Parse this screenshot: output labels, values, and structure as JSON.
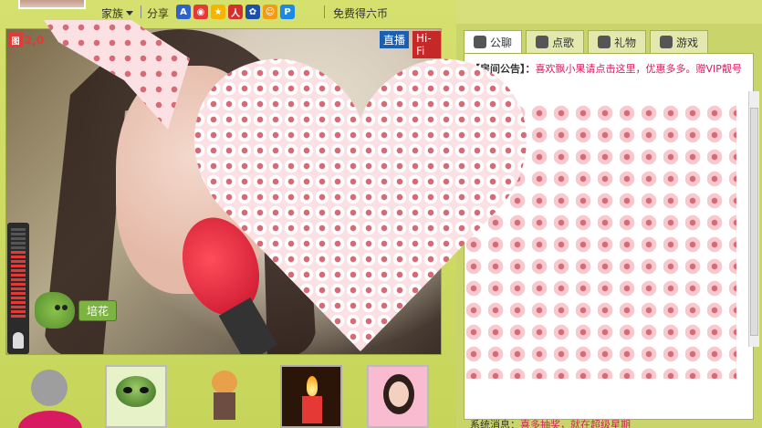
{
  "topbar": {
    "family_label": "家族",
    "share_label": "分享",
    "free_coin_label": "免费得六币",
    "share_icons": [
      "baidu-icon",
      "weibo-icon",
      "qzone-icon",
      "renren-icon",
      "paw-icon",
      "kaixin-icon",
      "pengyou-icon"
    ]
  },
  "video": {
    "live_label": "直播",
    "hifi_label": "Hi-Fi",
    "viewer_count": "2,0"
  },
  "peihua_label": "培花",
  "right": {
    "tabs": [
      {
        "label": "公聊",
        "icon": "chat-icon"
      },
      {
        "label": "点歌",
        "icon": "microphone-icon"
      },
      {
        "label": "礼物",
        "icon": "gift-icon"
      },
      {
        "label": "游戏",
        "icon": "gamepad-icon"
      }
    ],
    "announcement_label": "【房间公告】：",
    "announcement_text": "喜欢飘小果请点击这里，优惠多多。赠VIP靓号",
    "system_label": "系统消息：",
    "system_text": "喜多抽奖，就在超级星期"
  },
  "colors": {
    "background": "#c7d96a",
    "accent_pink": "#d81b60",
    "live_blue": "#1a5fb4",
    "hifi_red": "#c62828"
  }
}
